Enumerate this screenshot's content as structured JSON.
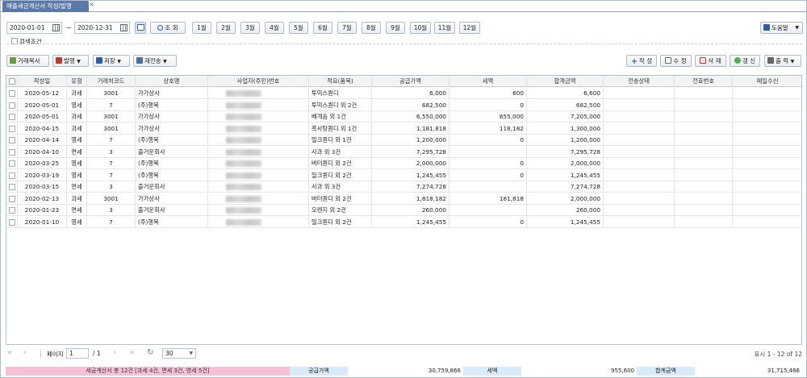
{
  "tab": {
    "title": "매출세금계산서 작성/발행"
  },
  "filter": {
    "start_date": "2020-01-01",
    "range_sep": "~",
    "end_date": "2020-12-31",
    "search_label": "조 회",
    "months": [
      "1월",
      "2월",
      "3월",
      "4월",
      "5월",
      "6월",
      "7월",
      "8월",
      "9월",
      "10월",
      "11월",
      "12월"
    ],
    "help_label": "도움말",
    "condition_label": "검색조건"
  },
  "toolbar": {
    "copy": "거래복사",
    "issue": "발행",
    "save": "저장",
    "resend": "재전송",
    "write": "작 성",
    "edit": "수 정",
    "delete": "삭 제",
    "refresh": "갱 신",
    "print": "출 력"
  },
  "grid": {
    "columns": [
      "",
      "작성일",
      "유형",
      "거래처코드",
      "상호명",
      "사업자(주민)번호",
      "적요(품목)",
      "공급가액",
      "세액",
      "합계금액",
      "전송상태",
      "전표번호",
      "메일수신"
    ],
    "rows": [
      [
        "2020-05-12",
        "과세",
        "3001",
        "가가상사",
        "",
        "투믹스퀀디",
        "6,000",
        "600",
        "6,600",
        "",
        "",
        ""
      ],
      [
        "2020-05-01",
        "영세",
        "7",
        "(주)행복",
        "",
        "투믹스퀀디 외 2건",
        "682,500",
        "0",
        "682,500",
        "",
        "",
        ""
      ],
      [
        "2020-05-01",
        "과세",
        "3001",
        "가가상사",
        "",
        "베개솜 외 1건",
        "6,550,000",
        "655,000",
        "7,205,000",
        "",
        "",
        ""
      ],
      [
        "2020-04-15",
        "과세",
        "3001",
        "가가상사",
        "",
        "흑사탕퀀디 외 1건",
        "1,181,818",
        "118,182",
        "1,300,000",
        "",
        "",
        ""
      ],
      [
        "2020-04-14",
        "영세",
        "7",
        "(주)행복",
        "",
        "밀크퀀디 외 1건",
        "1,200,000",
        "0",
        "1,200,000",
        "",
        "",
        ""
      ],
      [
        "2020-04-10",
        "면세",
        "3",
        "즐거운회사",
        "",
        "사과 외 3건",
        "7,295,728",
        "",
        "7,295,728",
        "",
        "",
        ""
      ],
      [
        "2020-03-25",
        "영세",
        "7",
        "(주)행복",
        "",
        "버터퀀디 외 2건",
        "2,000,000",
        "0",
        "2,000,000",
        "",
        "",
        ""
      ],
      [
        "2020-03-19",
        "영세",
        "7",
        "(주)행복",
        "",
        "밀크퀀디 외 2건",
        "1,245,455",
        "0",
        "1,245,455",
        "",
        "",
        ""
      ],
      [
        "2020-03-15",
        "면세",
        "3",
        "즐거운회사",
        "",
        "사과 외 3건",
        "7,274,728",
        "",
        "7,274,728",
        "",
        "",
        ""
      ],
      [
        "2020-02-13",
        "과세",
        "3001",
        "가가상사",
        "",
        "버터퀀디 외 2건",
        "1,818,182",
        "181,818",
        "2,000,000",
        "",
        "",
        ""
      ],
      [
        "2020-01-23",
        "면세",
        "3",
        "즐거운회사",
        "",
        "오렌지 외 2건",
        "260,000",
        "",
        "260,000",
        "",
        "",
        ""
      ],
      [
        "2020-01-10",
        "영세",
        "7",
        "(주)행복",
        "",
        "밀크퀀디 외 2건",
        "1,245,455",
        "0",
        "1,245,455",
        "",
        "",
        ""
      ]
    ]
  },
  "pager": {
    "page_label": "페이지",
    "current": "1",
    "total": "/ 1",
    "page_size": "30",
    "display": "표시 1 - 12 of 12"
  },
  "summary": {
    "count_text": "세금계산서 총 12건 [과세 4건, 면세 3건, 영세 5건]",
    "supply_label": "공급가액",
    "supply_value": "30,759,866",
    "tax_label": "세액",
    "tax_value": "955,600",
    "total_label": "합계금액",
    "total_value": "31,715,466"
  }
}
